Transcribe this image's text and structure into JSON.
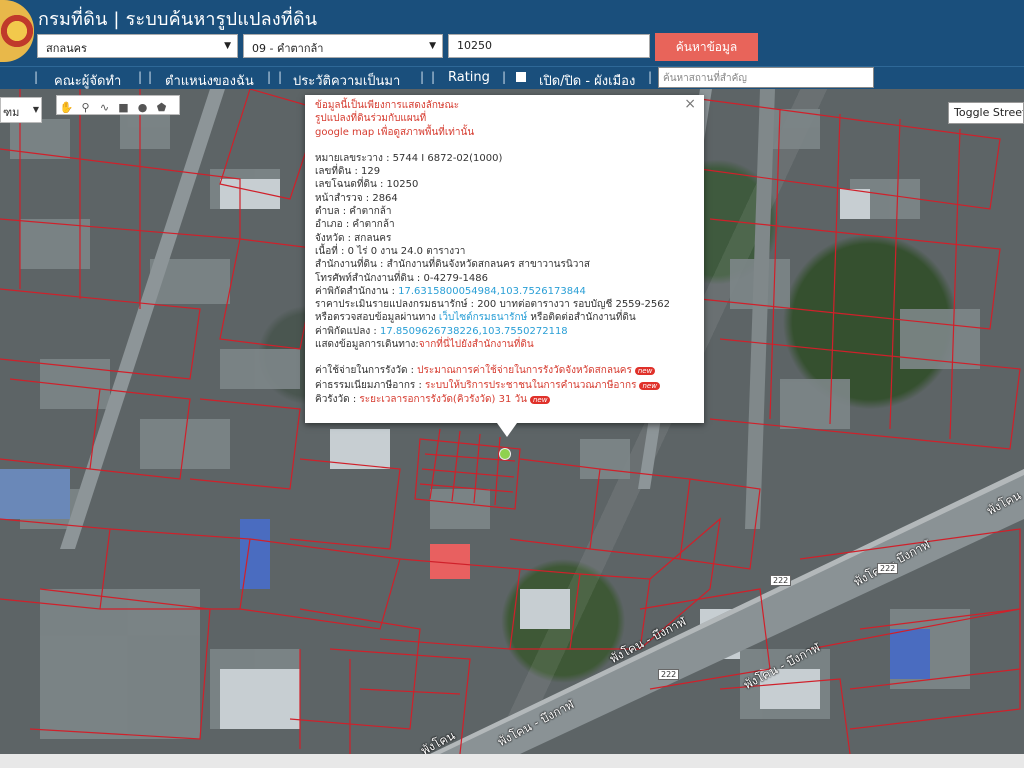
{
  "header": {
    "title": "กรมที่ดิน | ระบบค้นหารูปแปลงที่ดิน",
    "province": "สกลนคร",
    "district": "09 - คำตากล้า",
    "parcel_no": "10250",
    "search_label": "ค้นหาข้อมูล"
  },
  "nav": {
    "items": [
      "คณะผู้จัดทำ",
      "ตำแหน่งของฉัน",
      "ประวัติความเป็นมา",
      "Rating",
      "เปิด/ปิด - ผังเมือง"
    ],
    "place_placeholder": "ค้นหาสถานที่สำคัญ"
  },
  "map": {
    "type_label": "ฑม",
    "toggle_label": "Toggle Street View",
    "roads": [
      "พังโคน - บึงกาฬ",
      "พังโคน - บึงกาฬ",
      "พังโคน - บึงกาฬ",
      "พังโคน - บึงกาฬ",
      "พังโคน",
      "พังโคน"
    ],
    "shields": [
      "222",
      "222",
      "222"
    ]
  },
  "popup": {
    "note": [
      "ข้อมูลนี้เป็นเพียงการแสดงลักษณะ",
      "รูปแปลงที่ดินร่วมกับแผนที่",
      "google map เพื่อดูสภาพพื้นที่เท่านั้น"
    ],
    "survey": "หมายเลขระวาง : 5744 I 6872-02(1000)",
    "land_no": "เลขที่ดิน : 129",
    "deed_no": "เลขโฉนดที่ดิน : 10250",
    "page": "หน้าสำรวจ : 2864",
    "subdistrict": "ตำบล : คำตากล้า",
    "amphoe": "อำเภอ : คำตากล้า",
    "province": "จังหวัด : สกลนคร",
    "area": "เนื้อที่ : 0 ไร่ 0 งาน 24.0 ตารางวา",
    "office": "สำนักงานที่ดิน : สำนักงานที่ดินจังหวัดสกลนคร สาขาวานรนิวาส",
    "phone": "โทรศัพท์สำนักงานที่ดิน : 0-4279-1486",
    "office_coord_label": "ค่าพิกัดสำนักงาน : ",
    "office_coord": "17.6315800054984,103.7526173844",
    "price": "ราคาประเมินรายแปลงกรมธนารักษ์ : 200 บาทต่อตารางวา รอบบัญชี 2559-2562",
    "check_pre": "หรือตรวจสอบข้อมูลผ่านทาง ",
    "check_link": "เว็บไซต์กรมธนารักษ์",
    "check_post": " หรือติดต่อสำนักงานที่ดิน",
    "parcel_coord_label": "ค่าพิกัดแปลง : ",
    "parcel_coord": "17.8509626738226,103.7550272118",
    "route_pre": "แสดงข้อมูลการเดินทาง:",
    "route_link": "จากที่นี่ไปยังสำนักงานที่ดิน",
    "fee_pre": "ค่าใช้จ่ายในการรังวัด : ",
    "fee_link": "ประมาณการค่าใช้จ่ายในการรังวัดจังหวัดสกลนคร",
    "tax_pre": "ค่าธรรมเนียมภาษีอากร : ",
    "tax_link": "ระบบให้บริการประชาชนในการคำนวณภาษีอากร",
    "queue_pre": "คิวรังวัด : ",
    "queue_link": "ระยะเวลารอการรังวัด(คิวรังวัด) 31 วัน",
    "new_badge": "new",
    "close": "×"
  },
  "colors": {
    "header": "#1a4f7c",
    "search_button": "#e8645a",
    "parcel_line": "#d0202a",
    "link": "#2a9fd6"
  }
}
